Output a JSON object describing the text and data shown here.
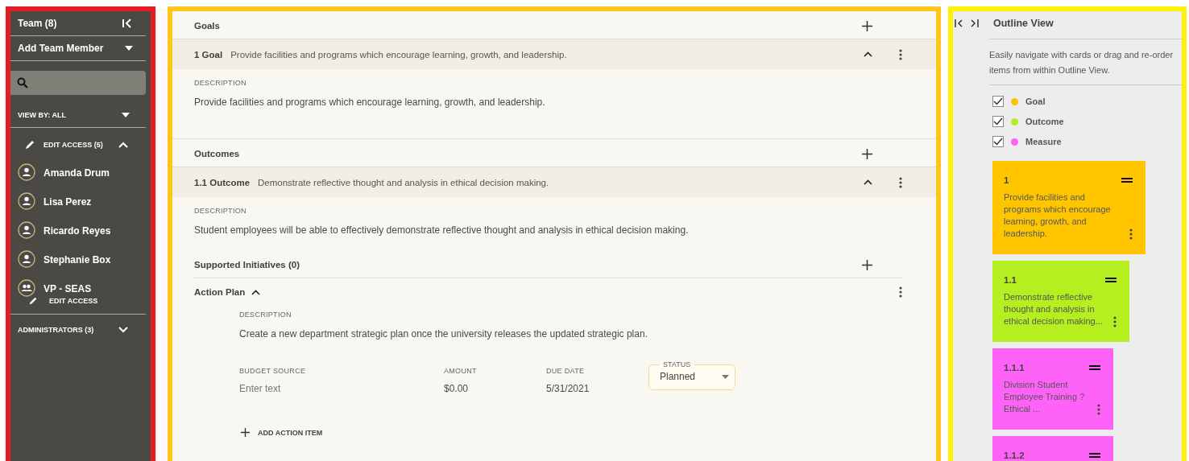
{
  "sidebar": {
    "title": "Team (8)",
    "add_member": "Add Team Member",
    "view_by": "VIEW BY: ALL",
    "groups": [
      {
        "label": "EDIT ACCESS (5)",
        "expanded": true,
        "members": [
          {
            "name": "Amanda Drum",
            "kind": "person"
          },
          {
            "name": "Lisa Perez",
            "kind": "person"
          },
          {
            "name": "Ricardo Reyes",
            "kind": "person"
          },
          {
            "name": "Stephanie Box",
            "kind": "person"
          },
          {
            "name": "VP - SEAS",
            "kind": "group",
            "access": "EDIT ACCESS"
          }
        ]
      },
      {
        "label": "ADMINISTRATORS (3)",
        "expanded": false
      }
    ]
  },
  "main": {
    "sections": [
      {
        "heading": "Goals",
        "item": {
          "number": "1 Goal",
          "title": "Provide facilities and programs which encourage learning, growth, and leadership.",
          "expanded": true,
          "description_label": "DESCRIPTION",
          "description": "Provide facilities and programs which encourage learning, growth, and leadership."
        }
      },
      {
        "heading": "Outcomes",
        "item": {
          "number": "1.1 Outcome",
          "title": "Demonstrate reflective thought and analysis in ethical decision making.",
          "expanded": true,
          "description_label": "DESCRIPTION",
          "description": "Student employees will be able to effectively demonstrate reflective thought and analysis in ethical decision making."
        }
      }
    ],
    "supported_initiatives": "Supported Initiatives (0)",
    "action_plan": {
      "title": "Action Plan",
      "expanded": true,
      "description_label": "DESCRIPTION",
      "description": "Create a new department strategic plan once the university releases the updated strategic plan.",
      "fields": [
        {
          "label": "BUDGET SOURCE",
          "kind": "input",
          "placeholder": "Enter text"
        },
        {
          "label": "AMOUNT",
          "kind": "text",
          "value": "$0.00"
        },
        {
          "label": "DUE DATE",
          "kind": "text",
          "value": "5/31/2021"
        },
        {
          "label": "STATUS",
          "kind": "select",
          "value": "Planned"
        }
      ],
      "add_item": "ADD ACTION ITEM"
    }
  },
  "outline": {
    "title": "Outline View",
    "intro": "Easily navigate with cards or drag and re-order items from within Outline View.",
    "filters": [
      {
        "label": "Goal",
        "checked": true,
        "color": "#ffc107"
      },
      {
        "label": "Outcome",
        "checked": true,
        "color": "#b5ee1f"
      },
      {
        "label": "Measure",
        "checked": true,
        "color": "#ff62f7"
      }
    ],
    "cards": [
      {
        "number": "1",
        "text": "Provide facilities and programs which encourage learning, growth, and leadership.",
        "color": "#ffc600"
      },
      {
        "number": "1.1",
        "text": "Demonstrate reflective thought and analysis in ethical decision making...",
        "color": "#b5ef20"
      },
      {
        "number": "1.1.1",
        "text": "Division Student Employee Training ? Ethical ...",
        "color": "#ff62f7"
      },
      {
        "number": "1.1.2",
        "color": "#ff62f7"
      }
    ]
  }
}
